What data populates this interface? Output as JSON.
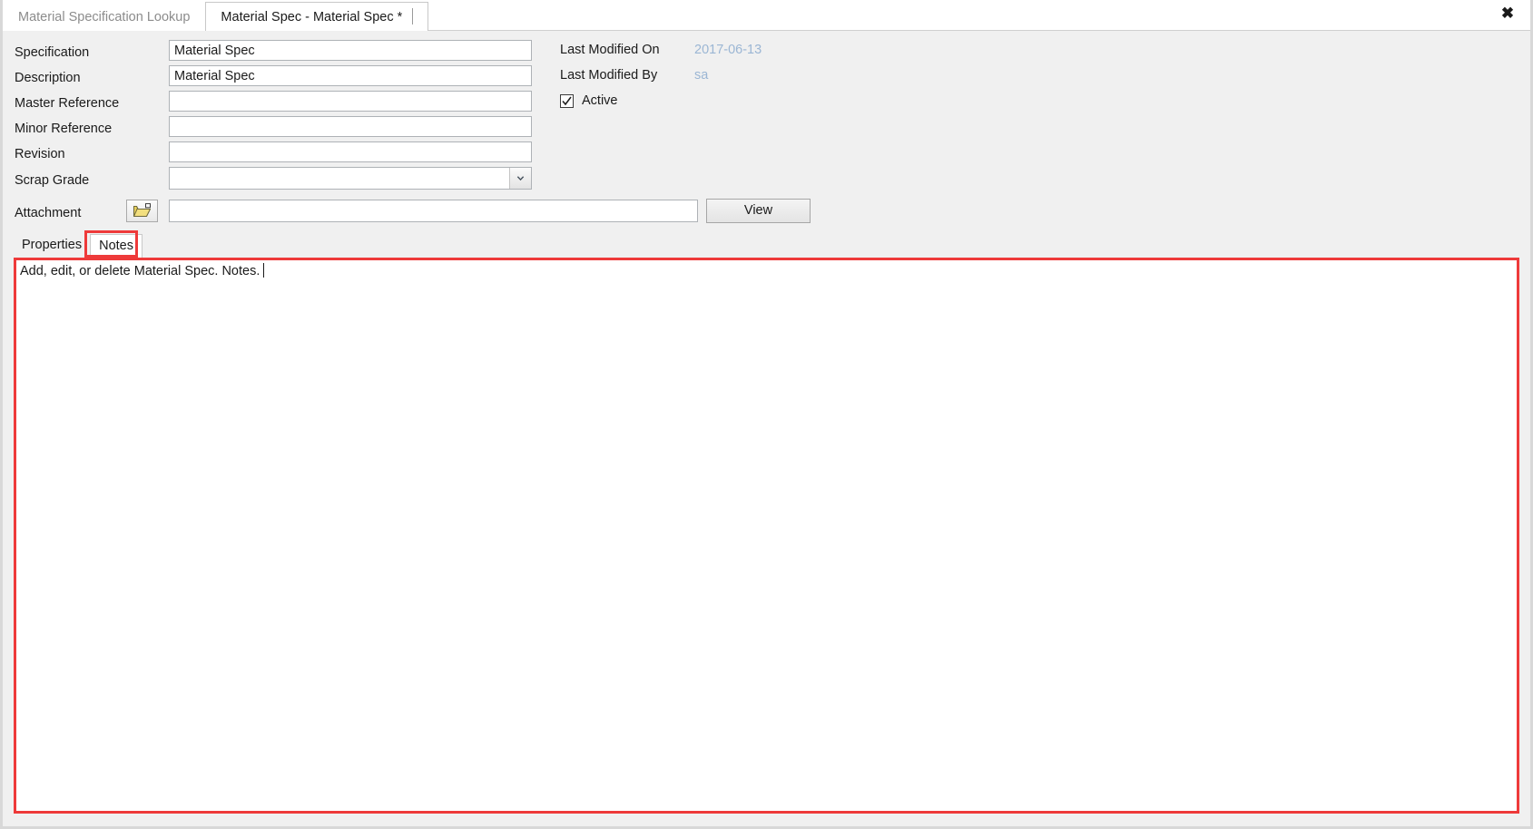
{
  "window": {
    "close_label": "✖"
  },
  "document_tabs": [
    {
      "label": "Material Specification Lookup",
      "active": false
    },
    {
      "label": "Material Spec - Material Spec *",
      "active": true
    }
  ],
  "form": {
    "fields": [
      {
        "label": "Specification",
        "value": "Material Spec",
        "type": "text"
      },
      {
        "label": "Description",
        "value": "Material Spec",
        "type": "text"
      },
      {
        "label": "Master Reference",
        "value": "",
        "type": "text"
      },
      {
        "label": "Minor Reference",
        "value": "",
        "type": "text"
      },
      {
        "label": "Revision",
        "value": "",
        "type": "text"
      },
      {
        "label": "Scrap Grade",
        "value": "",
        "type": "combo"
      }
    ],
    "attachment": {
      "label": "Attachment",
      "value": "",
      "browse_icon": "open-folder-icon",
      "view_button": "View"
    },
    "meta": {
      "last_modified_on_label": "Last Modified On",
      "last_modified_on_value": "2017-06-13",
      "last_modified_by_label": "Last Modified By",
      "last_modified_by_value": "sa",
      "active_label": "Active",
      "active_checked": true
    }
  },
  "lower_tabs": [
    {
      "label": "Properties",
      "selected": false
    },
    {
      "label": "Notes",
      "selected": true
    }
  ],
  "notes": {
    "text": "Add, edit, or delete Material Spec. Notes."
  },
  "colors": {
    "highlight": "#ee3a3a",
    "meta_value": "#9bb6d4",
    "panel_bg": "#f0f0f0",
    "field_border": "#aeb2b6"
  }
}
